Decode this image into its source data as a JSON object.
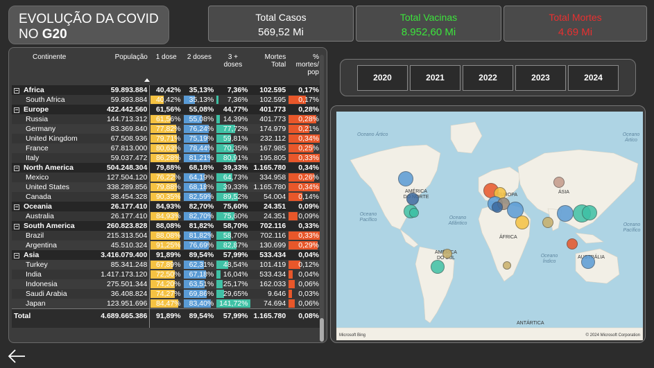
{
  "title": {
    "line1": "EVOLUÇÃO DA COVID",
    "line2_prefix": "NO ",
    "line2_bold": "G20"
  },
  "kpis": [
    {
      "label": "Total Casos",
      "value": "569,52 Mi",
      "color": "#ffffff"
    },
    {
      "label": "Total Vacinas",
      "value": "8.952,60 Mi",
      "color": "#3ce43c"
    },
    {
      "label": "Total Mortes",
      "value": "4.69 Mi",
      "color": "#e83030"
    }
  ],
  "colors": {
    "dose1": "#f5c242",
    "dose2": "#5a9bd5",
    "dose3": "#3fc1a5",
    "deaths": "#e8572a"
  },
  "table": {
    "headers": {
      "continent": "Continente",
      "population": "População",
      "dose1": "1 dose",
      "dose2": "2 doses",
      "dose3": "3 + doses",
      "deaths": "Mortes Total",
      "pct": "% mortes/ pop"
    },
    "rows": [
      {
        "kind": "grp",
        "name": "Africa",
        "pop": "59.893.884",
        "d1": "40,42%",
        "d2": "35,13%",
        "d3": "7,36%",
        "deaths": "102.595",
        "pct": "0,17%",
        "v1": 40.42,
        "v2": 35.13,
        "v3": 7.36,
        "vp": 0.17
      },
      {
        "kind": "child",
        "name": "South Africa",
        "pop": "59.893.884",
        "d1": "40,42%",
        "d2": "35,13%",
        "d3": "7,36%",
        "deaths": "102.595",
        "pct": "0,17%",
        "v1": 40.42,
        "v2": 35.13,
        "v3": 7.36,
        "vp": 0.17
      },
      {
        "kind": "grp",
        "name": "Europe",
        "pop": "422.442.560",
        "d1": "61,56%",
        "d2": "55,08%",
        "d3": "44,77%",
        "deaths": "401.773",
        "pct": "0,28%",
        "v1": 61.56,
        "v2": 55.08,
        "v3": 44.77,
        "vp": 0.28
      },
      {
        "kind": "child",
        "name": "Russia",
        "pop": "144.713.312",
        "d1": "61,56%",
        "d2": "55,08%",
        "d3": "14,39%",
        "deaths": "401.773",
        "pct": "0,28%",
        "v1": 61.56,
        "v2": 55.08,
        "v3": 14.39,
        "vp": 0.28
      },
      {
        "kind": "child",
        "name": "Germany",
        "pop": "83.369.840",
        "d1": "77,82%",
        "d2": "76,24%",
        "d3": "77,72%",
        "deaths": "174.979",
        "pct": "0,21%",
        "v1": 77.82,
        "v2": 76.24,
        "v3": 77.72,
        "vp": 0.21
      },
      {
        "kind": "child",
        "name": "United Kingdom",
        "pop": "67.508.936",
        "d1": "79,71%",
        "d2": "75,19%",
        "d3": "59,81%",
        "deaths": "232.112",
        "pct": "0,34%",
        "v1": 79.71,
        "v2": 75.19,
        "v3": 59.81,
        "vp": 0.34
      },
      {
        "kind": "child",
        "name": "France",
        "pop": "67.813.000",
        "d1": "80,63%",
        "d2": "78,44%",
        "d3": "70,35%",
        "deaths": "167.985",
        "pct": "0,25%",
        "v1": 80.63,
        "v2": 78.44,
        "v3": 70.35,
        "vp": 0.25
      },
      {
        "kind": "child",
        "name": "Italy",
        "pop": "59.037.472",
        "d1": "86,28%",
        "d2": "81,21%",
        "d3": "80,91%",
        "deaths": "195.805",
        "pct": "0,33%",
        "v1": 86.28,
        "v2": 81.21,
        "v3": 80.91,
        "vp": 0.33
      },
      {
        "kind": "grp",
        "name": "North America",
        "pop": "504.248.304",
        "d1": "79,88%",
        "d2": "68,18%",
        "d3": "39,33%",
        "deaths": "1.165.780",
        "pct": "0,34%",
        "v1": 79.88,
        "v2": 68.18,
        "v3": 39.33,
        "vp": 0.34
      },
      {
        "kind": "child",
        "name": "Mexico",
        "pop": "127.504.120",
        "d1": "76,22%",
        "d2": "64,19%",
        "d3": "64,73%",
        "deaths": "334.958",
        "pct": "0,26%",
        "v1": 76.22,
        "v2": 64.19,
        "v3": 64.73,
        "vp": 0.26
      },
      {
        "kind": "child",
        "name": "United States",
        "pop": "338.289.856",
        "d1": "79,88%",
        "d2": "68,18%",
        "d3": "39,33%",
        "deaths": "1.165.780",
        "pct": "0,34%",
        "v1": 79.88,
        "v2": 68.18,
        "v3": 39.33,
        "vp": 0.34
      },
      {
        "kind": "child",
        "name": "Canada",
        "pop": "38.454.328",
        "d1": "90,35%",
        "d2": "82,59%",
        "d3": "89,52%",
        "deaths": "54.004",
        "pct": "0,14%",
        "v1": 90.35,
        "v2": 82.59,
        "v3": 89.52,
        "vp": 0.14
      },
      {
        "kind": "grp",
        "name": "Oceania",
        "pop": "26.177.410",
        "d1": "84,93%",
        "d2": "82,70%",
        "d3": "75,60%",
        "deaths": "24.351",
        "pct": "0,09%",
        "v1": 84.93,
        "v2": 82.7,
        "v3": 75.6,
        "vp": 0.09
      },
      {
        "kind": "child",
        "name": "Australia",
        "pop": "26.177.410",
        "d1": "84,93%",
        "d2": "82,70%",
        "d3": "75,60%",
        "deaths": "24.351",
        "pct": "0,09%",
        "v1": 84.93,
        "v2": 82.7,
        "v3": 75.6,
        "vp": 0.09
      },
      {
        "kind": "grp",
        "name": "South America",
        "pop": "260.823.828",
        "d1": "88,08%",
        "d2": "81,82%",
        "d3": "58,70%",
        "deaths": "702.116",
        "pct": "0,33%",
        "v1": 88.08,
        "v2": 81.82,
        "v3": 58.7,
        "vp": 0.33
      },
      {
        "kind": "child",
        "name": "Brazil",
        "pop": "215.313.504",
        "d1": "88,08%",
        "d2": "81,82%",
        "d3": "58,70%",
        "deaths": "702.116",
        "pct": "0,33%",
        "v1": 88.08,
        "v2": 81.82,
        "v3": 58.7,
        "vp": 0.33
      },
      {
        "kind": "child",
        "name": "Argentina",
        "pop": "45.510.324",
        "d1": "91,25%",
        "d2": "76,69%",
        "d3": "82,87%",
        "deaths": "130.699",
        "pct": "0,29%",
        "v1": 91.25,
        "v2": 76.69,
        "v3": 82.87,
        "vp": 0.29
      },
      {
        "kind": "grp",
        "name": "Asia",
        "pop": "3.416.079.400",
        "d1": "91,89%",
        "d2": "89,54%",
        "d3": "57,99%",
        "deaths": "533.434",
        "pct": "0,04%",
        "v1": 91.89,
        "v2": 89.54,
        "v3": 57.99,
        "vp": 0.04
      },
      {
        "kind": "child",
        "name": "Turkey",
        "pop": "85.341.248",
        "d1": "67,89%",
        "d2": "62,31%",
        "d3": "48,54%",
        "deaths": "101.419",
        "pct": "0,12%",
        "v1": 67.89,
        "v2": 62.31,
        "v3": 48.54,
        "vp": 0.12
      },
      {
        "kind": "child",
        "name": "India",
        "pop": "1.417.173.120",
        "d1": "72,50%",
        "d2": "67,18%",
        "d3": "16,04%",
        "deaths": "533.434",
        "pct": "0,04%",
        "v1": 72.5,
        "v2": 67.18,
        "v3": 16.04,
        "vp": 0.04
      },
      {
        "kind": "child",
        "name": "Indonesia",
        "pop": "275.501.344",
        "d1": "74,20%",
        "d2": "63,51%",
        "d3": "25,17%",
        "deaths": "162.033",
        "pct": "0,06%",
        "v1": 74.2,
        "v2": 63.51,
        "v3": 25.17,
        "vp": 0.06
      },
      {
        "kind": "child",
        "name": "Saudi Arabia",
        "pop": "36.408.824",
        "d1": "74,27%",
        "d2": "69,86%",
        "d3": "29,65%",
        "deaths": "9.646",
        "pct": "0,03%",
        "v1": 74.27,
        "v2": 69.86,
        "v3": 29.65,
        "vp": 0.03
      },
      {
        "kind": "child",
        "name": "Japan",
        "pop": "123.951.696",
        "d1": "84,47%",
        "d2": "83,40%",
        "d3": "141,72%",
        "deaths": "74.694",
        "pct": "0,06%",
        "v1": 84.47,
        "v2": 83.4,
        "v3": 141.72,
        "vp": 0.06
      }
    ],
    "total": {
      "name": "Total",
      "pop": "4.689.665.386",
      "d1": "91,89%",
      "d2": "89,54%",
      "d3": "57,99%",
      "deaths": "1.165.780",
      "pct": "0,08%"
    }
  },
  "years": [
    "2020",
    "2021",
    "2022",
    "2023",
    "2024"
  ],
  "map": {
    "labels": {
      "na": "AMÉRICA DO NORTE",
      "sa": "AMÉRICA DO SUL",
      "eu": "EUROPA",
      "af": "ÁFRICA",
      "as": "ÁSIA",
      "au": "AUSTRÁLIA",
      "an": "ANTÁRTICA"
    },
    "oceans": {
      "arctic_l": "Oceano Ártico",
      "arctic_r": "Oceano Ártico",
      "pac_l": "Oceano Pacífico",
      "atl": "Oceano Atlântico",
      "ind": "Oceano Índico",
      "pac_r": "Oceano Pacífico"
    },
    "attribution": "Microsoft Bing",
    "copyright": "© 2024 Microsoft Corporation"
  },
  "icons": {
    "back": "arrow-left-icon"
  }
}
